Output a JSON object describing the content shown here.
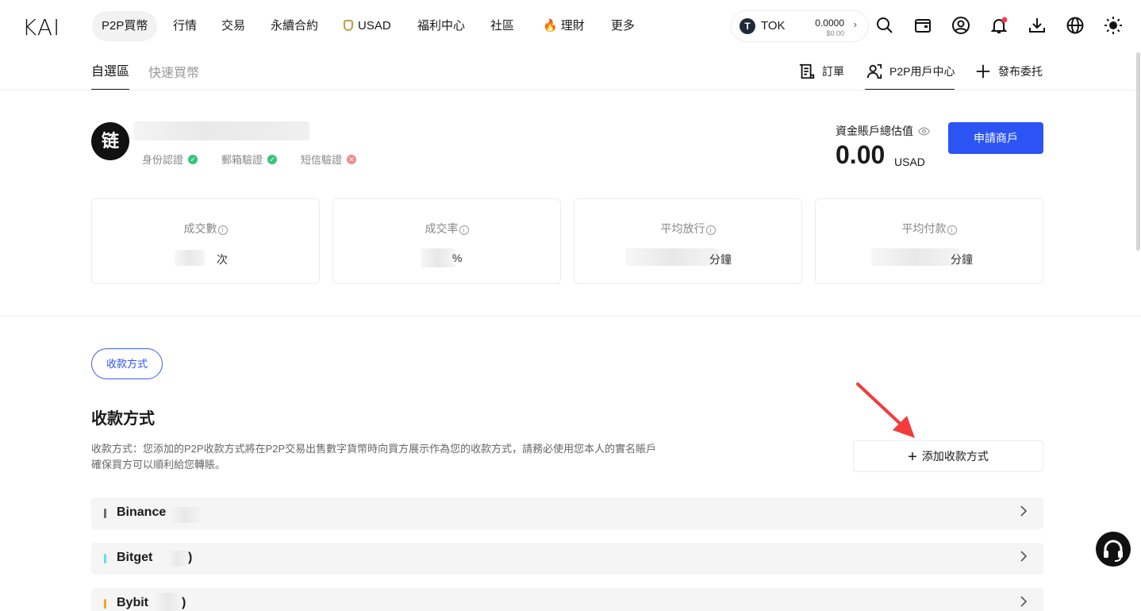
{
  "nav": {
    "logo": "KAI",
    "items": [
      {
        "label": "P2P買幣",
        "active": true
      },
      {
        "label": "行情"
      },
      {
        "label": "交易"
      },
      {
        "label": "永續合約"
      },
      {
        "label": "USAD"
      },
      {
        "label": "福利中心"
      },
      {
        "label": "社區"
      },
      {
        "label": "理財"
      },
      {
        "label": "更多"
      }
    ],
    "token": {
      "symbol": "TOK",
      "icon": "T",
      "balance": "0.0000",
      "usd": "$0.00"
    },
    "icons": [
      "search-icon",
      "wallet-icon",
      "user-icon",
      "bell-icon",
      "download-icon",
      "globe-icon",
      "theme-sun-icon"
    ]
  },
  "subnav": {
    "tabs": [
      {
        "label": "自選區",
        "active": true
      },
      {
        "label": "快速買幣"
      }
    ],
    "right": [
      {
        "label": "訂單",
        "icon": "order-icon"
      },
      {
        "label": "P2P用戶中心",
        "icon": "users-icon",
        "active": true
      },
      {
        "label": "發布委托",
        "icon": "plus-icon"
      }
    ]
  },
  "profile": {
    "avatar": "链",
    "verifications": [
      {
        "label": "身份認證",
        "status": "ok"
      },
      {
        "label": "郵箱驗證",
        "status": "ok"
      },
      {
        "label": "短信驗證",
        "status": "fail"
      }
    ],
    "asset_label": "資金賬戶總估值",
    "asset_value": "0.00",
    "asset_unit": "USAD",
    "apply_button": "申請商戶"
  },
  "stats": [
    {
      "title": "成交數",
      "suffix": "次"
    },
    {
      "title": "成交率",
      "suffix": "%"
    },
    {
      "title": "平均放行",
      "suffix": "分鐘"
    },
    {
      "title": "平均付款",
      "suffix": "分鐘"
    }
  ],
  "payments": {
    "tab": "收款方式",
    "title": "收款方式",
    "description": "收款方式：您添加的P2P收款方式將在P2P交易出售數字貨幣時向買方展示作為您的收款方式，請務必使用您本人的實名賬戶確保買方可以順利給您轉賬。",
    "add_button": "添加收款方式",
    "methods": [
      {
        "name": "Binance",
        "color": "#6b6b6b",
        "tail": ""
      },
      {
        "name": "Bitget",
        "color": "#5fe0f0",
        "tail": ")"
      },
      {
        "name": "Bybit",
        "color": "#f5a623",
        "tail": ")"
      }
    ]
  },
  "colors": {
    "accent": "#2c54f5",
    "annotation_arrow": "#f23c3c"
  }
}
